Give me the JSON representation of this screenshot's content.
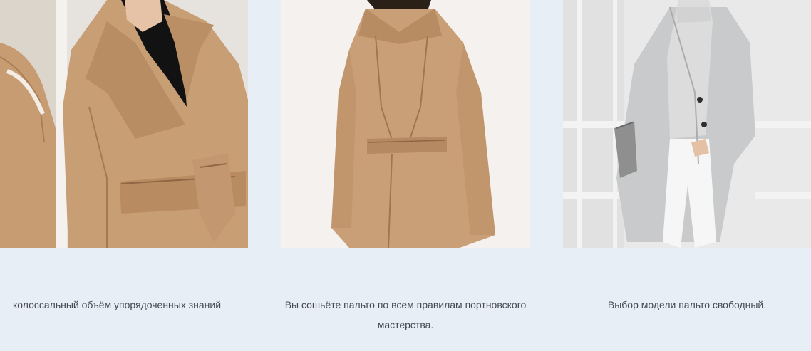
{
  "cards": [
    {
      "image_subject": "camel-wrap-coat-front",
      "caption": "колоссальный объём упорядоченных знаний"
    },
    {
      "image_subject": "camel-wrap-coat-back",
      "caption": "Вы сошьёте пальто по всем правилам портновского мастерства."
    },
    {
      "image_subject": "grey-wool-coat",
      "caption": "Выбор модели пальто свободный."
    }
  ],
  "colors": {
    "page_background": "#e8eef5",
    "caption_text": "#444a55",
    "camel": "#c89e74",
    "grey_coat": "#c9cbcc"
  }
}
